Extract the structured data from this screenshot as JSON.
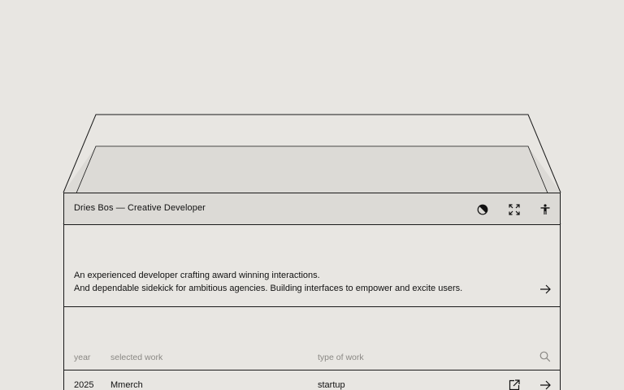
{
  "header": {
    "title": "Dries Bos — Creative Developer",
    "icons": [
      "contrast-icon",
      "fullscreen-icon",
      "accessibility-icon"
    ]
  },
  "intro": {
    "line1": "An experienced developer crafting award winning interactions.",
    "line2": "And dependable sidekick for ambitious agencies. Building interfaces to empower and excite users."
  },
  "work_table": {
    "columns": {
      "year": "year",
      "selected_work": "selected work",
      "type": "type of work"
    },
    "rows": [
      {
        "year": "2025",
        "name": "Mmerch",
        "type": "startup"
      }
    ]
  },
  "colors": {
    "background": "#e8e6e2",
    "header_fill": "#dcdad6",
    "line": "#1a1a1a",
    "muted_text": "#8a8884"
  }
}
